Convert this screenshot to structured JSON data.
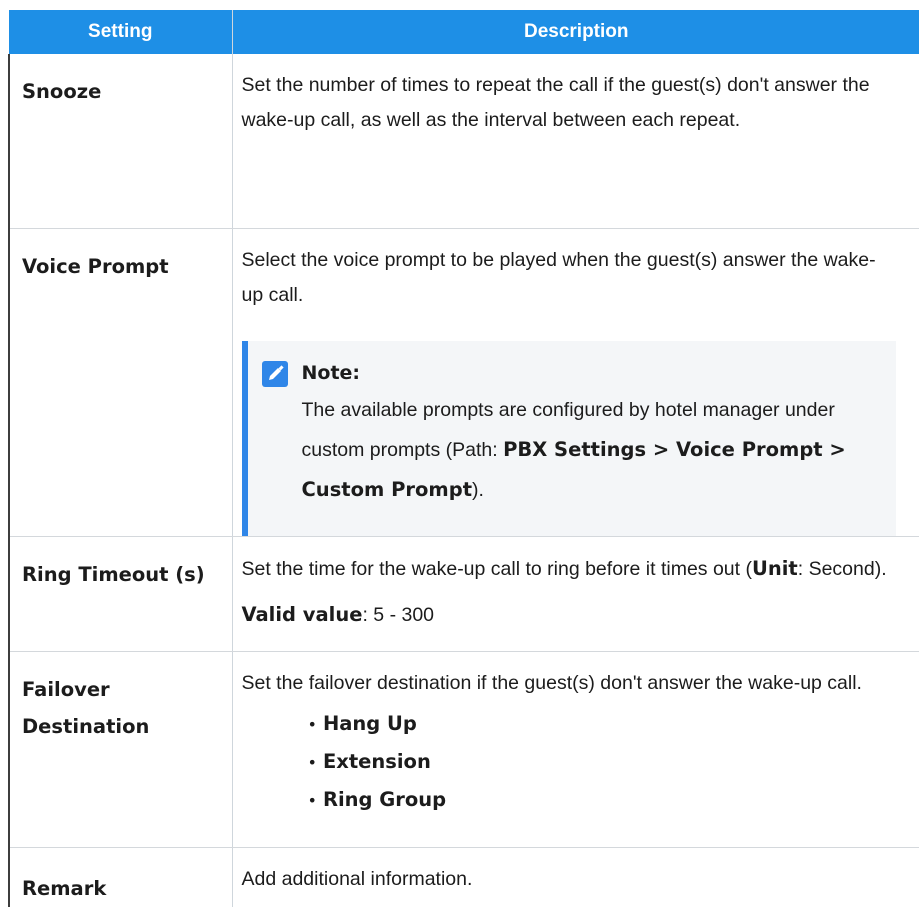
{
  "table": {
    "headers": [
      "Setting",
      "Description"
    ],
    "rows": {
      "snooze": {
        "name": "Snooze",
        "desc": "Set the number of times to repeat the call if the guest(s) don't answer the wake-up call, as well as the interval between each repeat."
      },
      "voice_prompt": {
        "name": "Voice Prompt",
        "desc": "Select the voice prompt to be played when the guest(s) answer the wake-up call.",
        "note": {
          "icon": "edit-note-icon",
          "title": "Note:",
          "text_before": "The available prompts are configured by hotel manager under custom prompts (Path: ",
          "path": "PBX Settings > Voice Prompt > Custom Prompt",
          "text_after": ")."
        }
      },
      "ring_timeout": {
        "name": "Ring Timeout (s)",
        "desc_before": "Set the time for the wake-up call to ring before it times out (",
        "unit_label": "Unit",
        "unit_value": ": Second).",
        "valid_label": "Valid value",
        "valid_value": ": 5 - 300"
      },
      "failover": {
        "name": "Failover Destination",
        "desc": "Set the failover destination if the guest(s) don't answer the wake-up call.",
        "options": [
          "Hang Up",
          "Extension",
          "Ring Group"
        ]
      },
      "remark": {
        "name": "Remark",
        "desc": "Add additional information."
      }
    }
  },
  "colors": {
    "header_bg": "#1e8fe6",
    "note_accent": "#2f86e8",
    "note_bg": "#f4f6f8"
  }
}
